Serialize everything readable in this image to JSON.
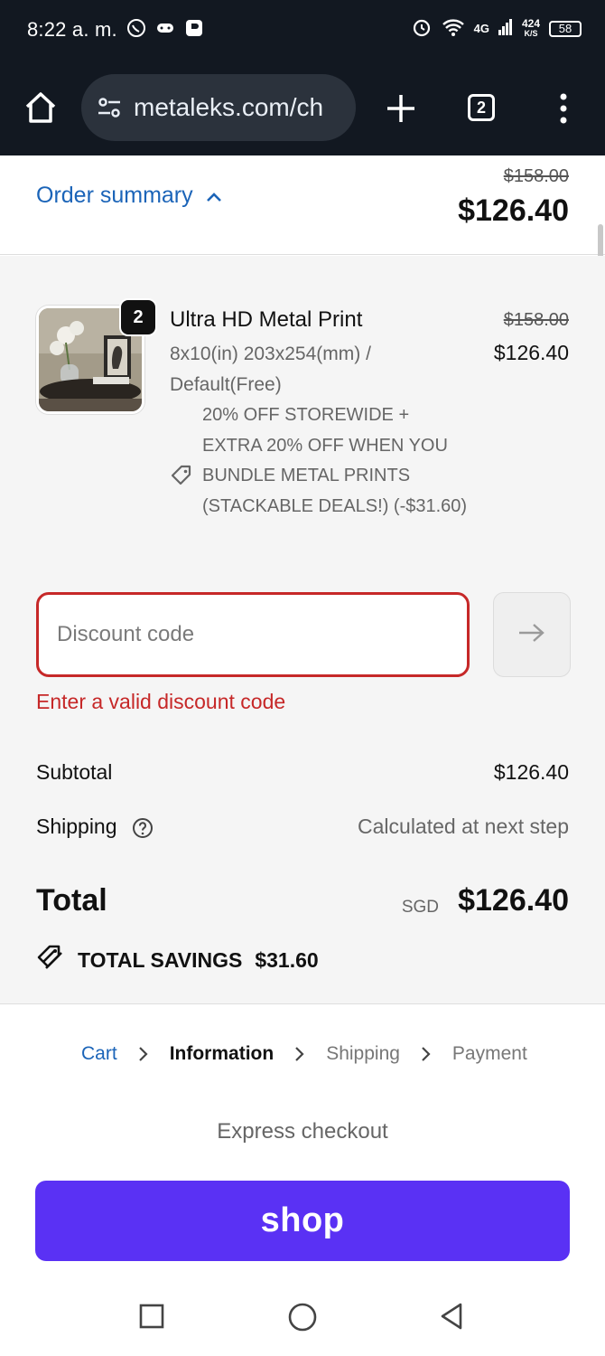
{
  "status_bar": {
    "time": "8:22 a. m.",
    "network": "4G",
    "speed": "424",
    "speed_unit": "K/S",
    "battery": "58"
  },
  "browser": {
    "url": "metaleks.com/ch",
    "tab_count": "2"
  },
  "summary": {
    "toggle_label": "Order summary",
    "original_total": "$158.00",
    "total": "$126.40"
  },
  "line_item": {
    "quantity": "2",
    "title": "Ultra HD Metal Print",
    "variant": "8x10(in) 203x254(mm) / Default(Free)",
    "original_price": "$158.00",
    "price": "$126.40",
    "discount_text": "20% OFF STOREWIDE + EXTRA 20% OFF WHEN YOU BUNDLE METAL PRINTS (STACKABLE DEALS!) (-$31.60)"
  },
  "discount": {
    "placeholder": "Discount code",
    "error": "Enter a valid discount code"
  },
  "totals": {
    "subtotal_label": "Subtotal",
    "subtotal_value": "$126.40",
    "shipping_label": "Shipping",
    "shipping_value": "Calculated at next step",
    "total_label": "Total",
    "currency": "SGD",
    "total_value": "$126.40",
    "savings_label": "TOTAL SAVINGS",
    "savings_value": "$31.60"
  },
  "breadcrumb": {
    "cart": "Cart",
    "information": "Information",
    "shipping": "Shipping",
    "payment": "Payment"
  },
  "express": {
    "label": "Express checkout",
    "shop_button": "shop"
  },
  "colors": {
    "link": "#1b64b8",
    "error": "#c62828",
    "shop": "#5a31f4"
  }
}
